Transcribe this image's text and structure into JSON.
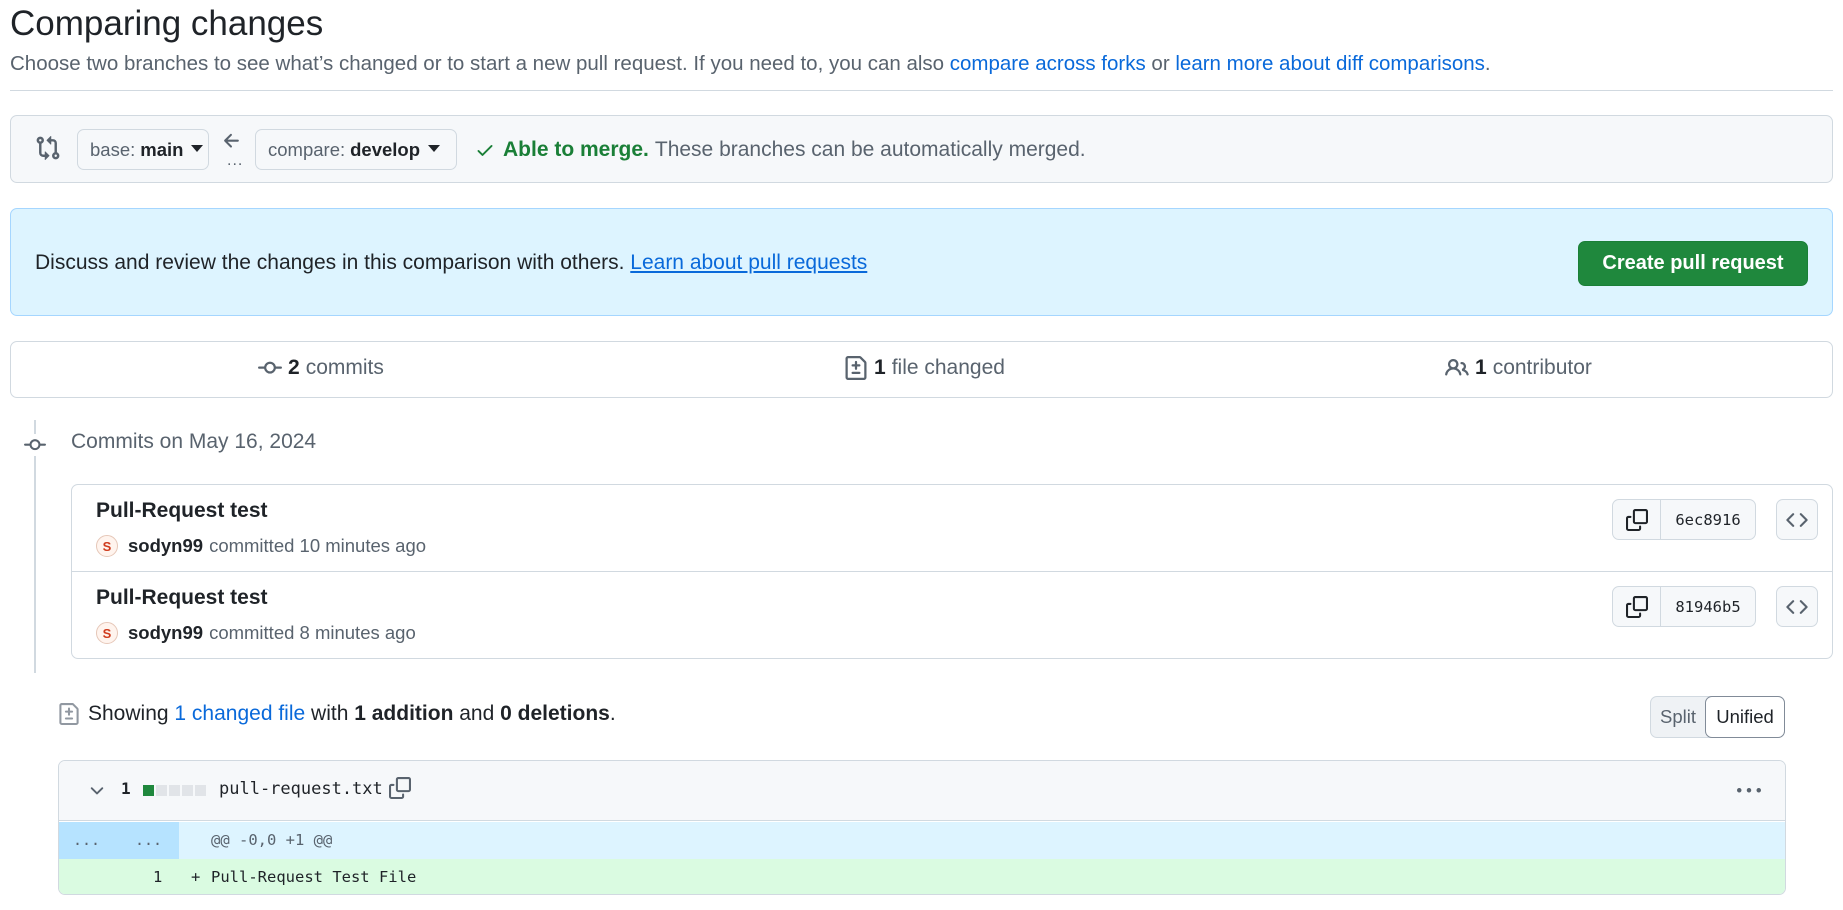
{
  "header": {
    "title": "Comparing changes",
    "desc_text": "Choose two branches to see what’s changed or to start a new pull request. If you need to, you can also ",
    "link_forks": "compare across forks",
    "desc_or": " or ",
    "link_learn": "learn more about diff comparisons",
    "desc_end": "."
  },
  "range": {
    "base_prefix": "base:",
    "base_branch": "main",
    "compare_prefix": "compare:",
    "compare_branch": "develop",
    "dots": "...",
    "merge_ok": "Able to merge.",
    "merge_text": "These branches can be automatically merged."
  },
  "banner": {
    "text": "Discuss and review the changes in this comparison with others. ",
    "link": "Learn about pull requests",
    "button": "Create pull request"
  },
  "summary": {
    "commits_count": "2",
    "commits_label": "commits",
    "files_count": "1",
    "files_label": "file changed",
    "contrib_count": "1",
    "contrib_label": "contributor"
  },
  "timeline": {
    "date_label": "Commits on May 16, 2024"
  },
  "commits": [
    {
      "title": "Pull-Request test",
      "author": "sodyn99",
      "action": "committed",
      "time": "10 minutes ago",
      "sha": "6ec8916"
    },
    {
      "title": "Pull-Request test",
      "author": "sodyn99",
      "action": "committed",
      "time": "8 minutes ago",
      "sha": "81946b5"
    }
  ],
  "diff_summary": {
    "showing": "Showing",
    "changed_link": "1 changed file",
    "with": "with",
    "additions": "1 addition",
    "and": "and",
    "deletions": "0 deletions",
    "end": "."
  },
  "view_toggle": {
    "split": "Split",
    "unified": "Unified",
    "selected": "Unified"
  },
  "file": {
    "change_count": "1",
    "name": "pull-request.txt",
    "diffstat": [
      "add",
      "neutral",
      "neutral",
      "neutral",
      "neutral"
    ],
    "hunk_left": "...",
    "hunk_right": "...",
    "hunk_header": "@@ -0,0 +1 @@",
    "line_number": "1",
    "line_sign": "+",
    "line_text": "Pull-Request Test File"
  },
  "colors": {
    "accent": "#0969da",
    "success": "#1a7f37",
    "button_green": "#1f883d",
    "banner_bg": "#ddf4ff",
    "addition_bg": "#dafbe1",
    "hunk_bg": "#ddf4ff"
  },
  "icons": [
    "git-compare-icon",
    "arrow-left-icon",
    "check-icon",
    "git-commit-icon",
    "file-diff-icon",
    "people-icon",
    "copy-icon",
    "code-icon",
    "chevron-down-icon",
    "kebab-horizontal-icon"
  ]
}
